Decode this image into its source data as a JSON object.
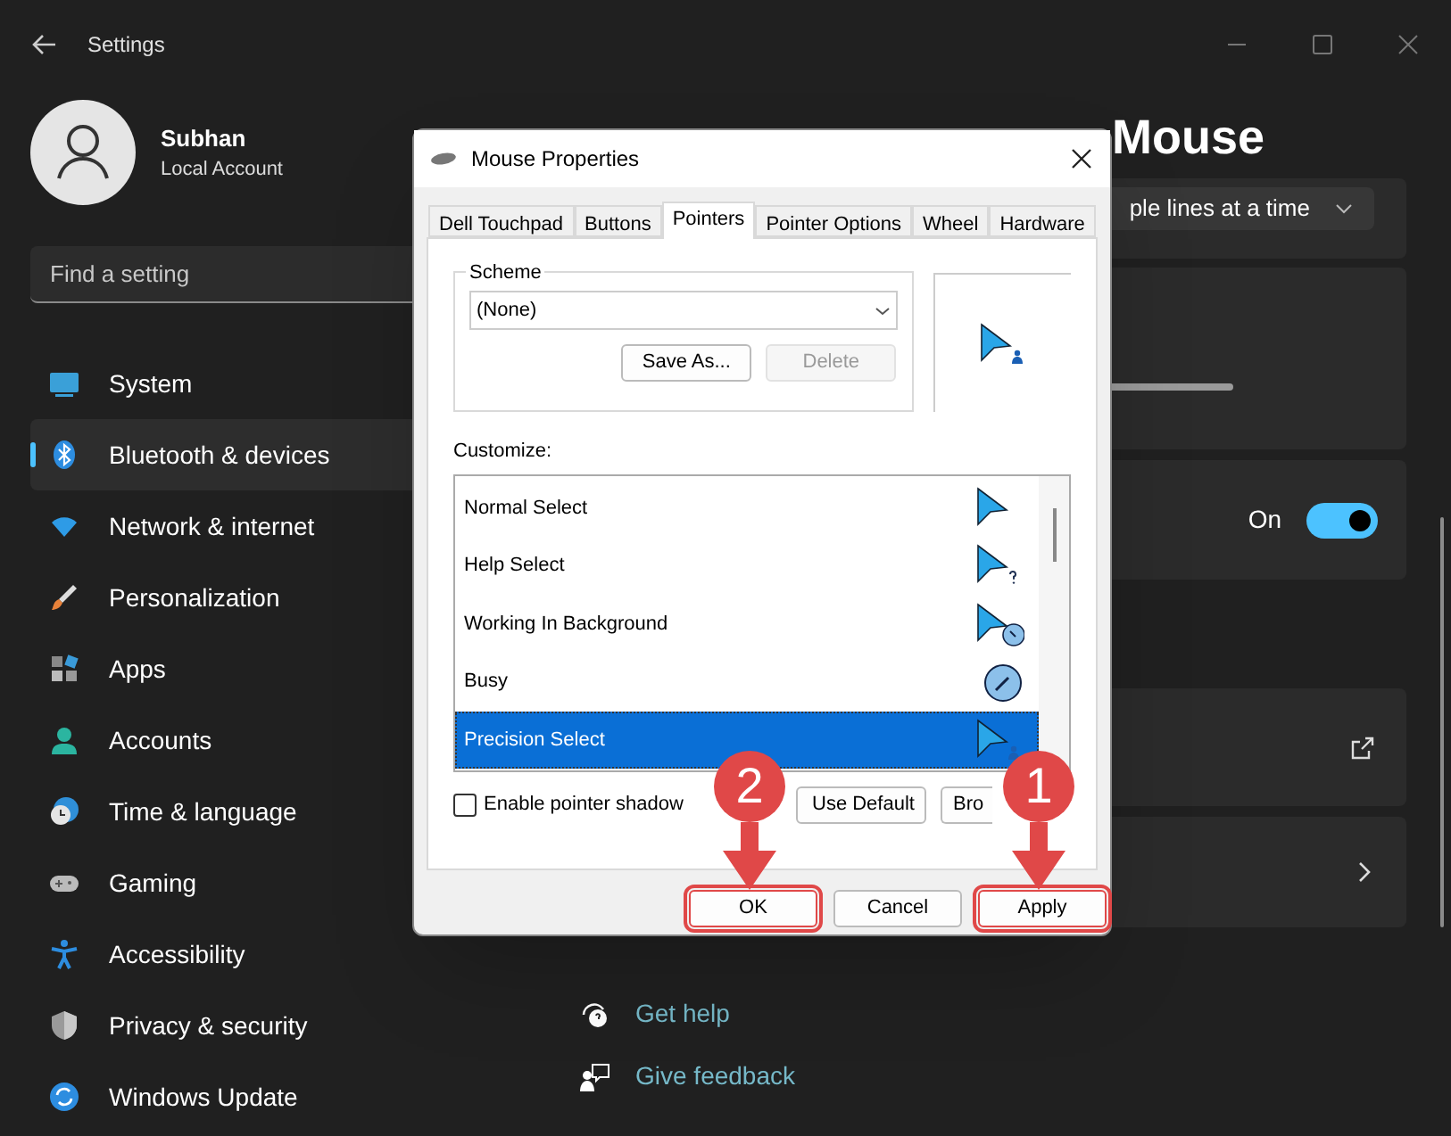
{
  "window": {
    "title": "Settings"
  },
  "account": {
    "name": "Subhan",
    "type": "Local Account"
  },
  "search": {
    "placeholder": "Find a setting"
  },
  "nav": [
    {
      "label": "System",
      "kind": "system",
      "selected": false
    },
    {
      "label": "Bluetooth & devices",
      "kind": "bluetooth",
      "selected": true
    },
    {
      "label": "Network & internet",
      "kind": "wifi",
      "selected": false
    },
    {
      "label": "Personalization",
      "kind": "brush",
      "selected": false
    },
    {
      "label": "Apps",
      "kind": "apps",
      "selected": false
    },
    {
      "label": "Accounts",
      "kind": "person",
      "selected": false
    },
    {
      "label": "Time & language",
      "kind": "clock",
      "selected": false
    },
    {
      "label": "Gaming",
      "kind": "gamepad",
      "selected": false
    },
    {
      "label": "Accessibility",
      "kind": "accessibility",
      "selected": false
    },
    {
      "label": "Privacy & security",
      "kind": "shield",
      "selected": false
    },
    {
      "label": "Windows Update",
      "kind": "update",
      "selected": false
    }
  ],
  "page": {
    "title": "Mouse",
    "scroll_setting": {
      "value": "ple lines at a time"
    },
    "toggle": {
      "label": "On",
      "on": true
    },
    "links": [
      {
        "label": "Get help",
        "kind": "help"
      },
      {
        "label": "Give feedback",
        "kind": "feedback"
      }
    ]
  },
  "dialog": {
    "title": "Mouse Properties",
    "tabs": [
      {
        "label": "Dell Touchpad",
        "selected": false
      },
      {
        "label": "Buttons",
        "selected": false
      },
      {
        "label": "Pointers",
        "selected": true
      },
      {
        "label": "Pointer Options",
        "selected": false
      },
      {
        "label": "Wheel",
        "selected": false
      },
      {
        "label": "Hardware",
        "selected": false
      }
    ],
    "scheme": {
      "label": "Scheme",
      "value": "(None)",
      "buttons": [
        {
          "label": "Save As...",
          "disabled": false
        },
        {
          "label": "Delete",
          "disabled": true
        }
      ]
    },
    "customize_label": "Customize:",
    "cursors": [
      {
        "label": "Normal Select",
        "kind": "arrow",
        "selected": false
      },
      {
        "label": "Help Select",
        "kind": "help",
        "selected": false
      },
      {
        "label": "Working In Background",
        "kind": "working",
        "selected": false
      },
      {
        "label": "Busy",
        "kind": "busy",
        "selected": false
      },
      {
        "label": "Precision Select",
        "kind": "person",
        "selected": true
      }
    ],
    "shadow": {
      "label": "Enable pointer shadow",
      "checked": false
    },
    "list_buttons": [
      "Use Default",
      "Bro"
    ],
    "buttons": [
      {
        "label": "OK",
        "step": "2"
      },
      {
        "label": "Cancel"
      },
      {
        "label": "Apply",
        "step": "1"
      }
    ]
  }
}
